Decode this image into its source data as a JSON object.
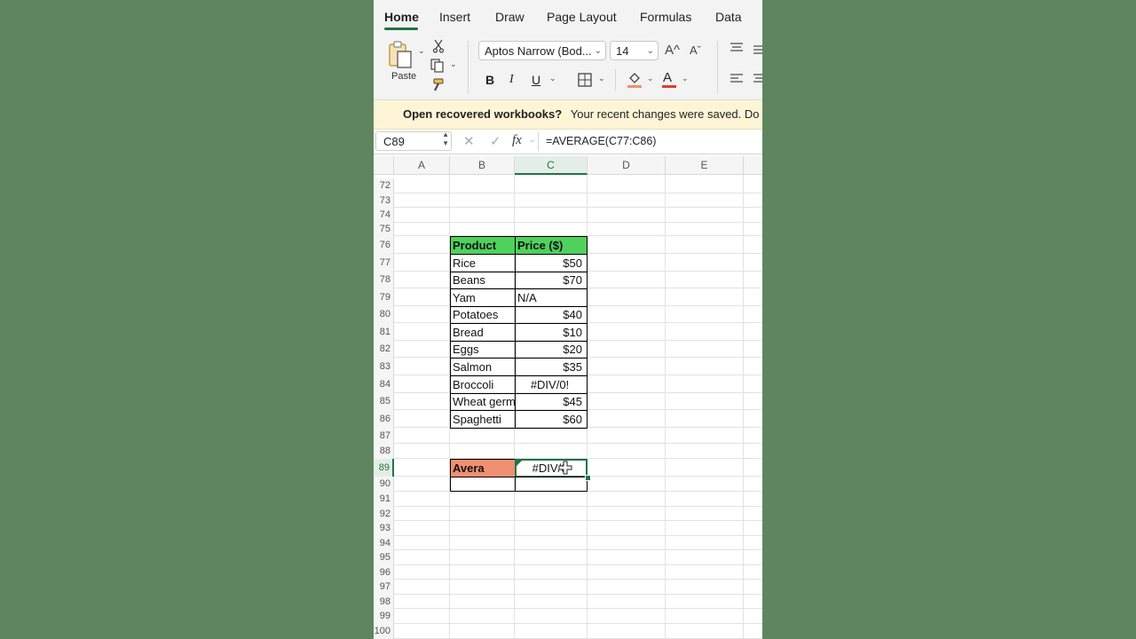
{
  "ribbon": {
    "tabs": [
      "Home",
      "Insert",
      "Draw",
      "Page Layout",
      "Formulas",
      "Data"
    ],
    "paste_label": "Paste",
    "font_name": "Aptos Narrow (Bod...",
    "font_size": "14",
    "bold": "B",
    "italic": "I",
    "underline": "U",
    "font_color_letter": "A",
    "grow_font": "A^",
    "shrink_font": "Aˇ",
    "fill_color": "#f08f72",
    "font_color": "#e03c31"
  },
  "notice": {
    "title": "Open recovered workbooks?",
    "message": "Your recent changes were saved. Do yo"
  },
  "formula_bar": {
    "name_box": "C89",
    "cancel": "✕",
    "enter": "✓",
    "fx": "fx",
    "formula": "=AVERAGE(C77:C86)"
  },
  "grid": {
    "columns": [
      "A",
      "B",
      "C",
      "D",
      "E"
    ],
    "rows": [
      "72",
      "73",
      "74",
      "75",
      "76",
      "77",
      "78",
      "79",
      "80",
      "81",
      "82",
      "83",
      "84",
      "85",
      "86",
      "87",
      "88",
      "89",
      "90",
      "91",
      "92",
      "93",
      "94",
      "95",
      "96",
      "97",
      "98",
      "99",
      "100"
    ],
    "selected_column": "C",
    "selected_row": "89"
  },
  "table": {
    "header_product": "Product",
    "header_price": "Price ($)",
    "items": [
      {
        "product": "Rice",
        "price": "$50"
      },
      {
        "product": "Beans",
        "price": "$70"
      },
      {
        "product": "Yam",
        "price": "N/A"
      },
      {
        "product": "Potatoes",
        "price": "$40"
      },
      {
        "product": "Bread",
        "price": "$10"
      },
      {
        "product": "Eggs",
        "price": "$20"
      },
      {
        "product": "Salmon",
        "price": "$35"
      },
      {
        "product": "Broccoli",
        "price": "#DIV/0!"
      },
      {
        "product": "Wheat germ",
        "price": "$45"
      },
      {
        "product": "Spaghetti",
        "price": "$60"
      }
    ],
    "average_label": "Avera",
    "average_value": "#DIV/0"
  },
  "colors": {
    "header_green": "#4fd15e",
    "average_fill": "#f08f72",
    "selection_green": "#217346",
    "background": "#5f8560"
  }
}
